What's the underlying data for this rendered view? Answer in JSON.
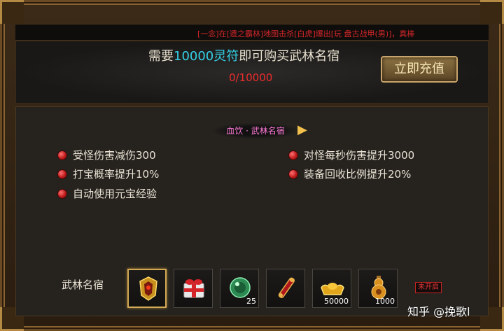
{
  "marquee": "[一念]在[遗之霸林]地图击杀[白虎]爆出[玩 盘古战甲(男)]，真棒",
  "buy": {
    "prefix": "需要",
    "amount": "10000灵符",
    "suffix": "即可购买武林名宿",
    "progress": "0/10000"
  },
  "recharge_label": "立即充值",
  "panel": {
    "title": "血饮 · 武林名宿",
    "attrs_left": [
      "受怪伤害减伤300",
      "打宝概率提升10%",
      "自动使用元宝经验"
    ],
    "attrs_right": [
      "对怪每秒伤害提升3000",
      "装备回收比例提升20%"
    ]
  },
  "slots": {
    "label": "武林名宿",
    "items": [
      {
        "icon": "golden-armor-icon",
        "count": "",
        "selected": true
      },
      {
        "icon": "gift-box-icon",
        "count": ""
      },
      {
        "icon": "green-gem-icon",
        "count": "25"
      },
      {
        "icon": "red-scroll-icon",
        "count": ""
      },
      {
        "icon": "gold-ingot-icon",
        "count": "50000"
      },
      {
        "icon": "gourd-flask-icon",
        "count": "1000"
      }
    ],
    "locked_label": "未开启"
  },
  "watermark": "知乎 @挽歌l",
  "colors": {
    "accent_cyan": "#33d1e8",
    "progress_red": "#ee2c2c",
    "title_pink": "#ff79d6"
  }
}
